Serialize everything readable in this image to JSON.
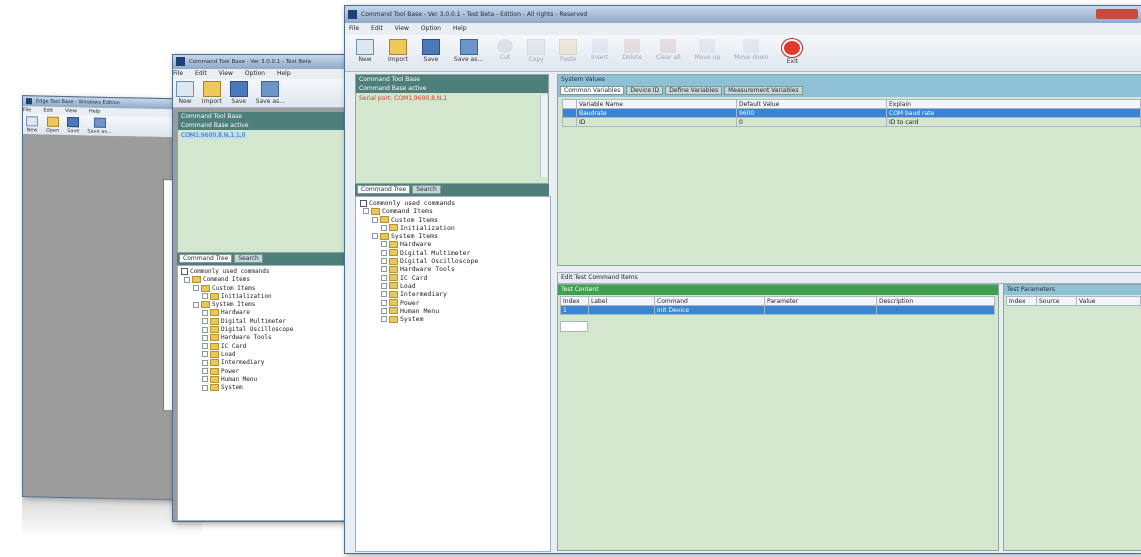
{
  "windows": {
    "back": {
      "title": "Edge Tool Base - Windows Edition",
      "menu": [
        "File",
        "Edit",
        "View",
        "Help"
      ],
      "toolbar": [
        "New",
        "Open",
        "Save",
        "Save as..."
      ]
    },
    "middle": {
      "title": "Command Tool Base - Ver 3.0.0.1 - Test Beta",
      "menu": [
        "File",
        "Edit",
        "View",
        "Option",
        "Help"
      ],
      "toolbar": [
        "New",
        "Import",
        "Save",
        "Save as..."
      ],
      "info_lines": [
        "Command Tool Base",
        "Command Base active"
      ],
      "info_value": "COM1:9600,8,N,1,1,0",
      "tabs": [
        "Command Tree",
        "Search"
      ],
      "filter_label": "Commonly used commands",
      "tree": [
        {
          "indent": 0,
          "label": "Command Items"
        },
        {
          "indent": 1,
          "label": "Custom Items"
        },
        {
          "indent": 2,
          "label": "Initialization"
        },
        {
          "indent": 1,
          "label": "System Items"
        },
        {
          "indent": 2,
          "label": "Hardware"
        },
        {
          "indent": 2,
          "label": "Digital Multimeter"
        },
        {
          "indent": 2,
          "label": "Digital Oscilloscope"
        },
        {
          "indent": 2,
          "label": "Hardware Tools"
        },
        {
          "indent": 2,
          "label": "IC Card"
        },
        {
          "indent": 2,
          "label": "Load"
        },
        {
          "indent": 2,
          "label": "Intermediary"
        },
        {
          "indent": 2,
          "label": "Power"
        },
        {
          "indent": 2,
          "label": "Human Menu"
        },
        {
          "indent": 2,
          "label": "System"
        }
      ]
    },
    "front": {
      "title": "Command Tool Base - Ver 3.0.0.1 - Test Beta - Edition - All rights - Reserved",
      "menu": [
        "File",
        "Edit",
        "View",
        "Option",
        "Help"
      ],
      "toolbar": [
        {
          "label": "New",
          "icon": "new-icon",
          "enabled": true
        },
        {
          "label": "Import",
          "icon": "open-icon",
          "enabled": true
        },
        {
          "label": "Save",
          "icon": "save-icon",
          "enabled": true
        },
        {
          "label": "Save as...",
          "icon": "save-as-icon",
          "enabled": true
        },
        {
          "label": "Cut",
          "icon": "cut-icon",
          "enabled": false
        },
        {
          "label": "Copy",
          "icon": "copy-icon",
          "enabled": false
        },
        {
          "label": "Paste",
          "icon": "paste-icon",
          "enabled": false
        },
        {
          "label": "Insert",
          "icon": "insert-icon",
          "enabled": false
        },
        {
          "label": "Delete",
          "icon": "delete-icon",
          "enabled": false
        },
        {
          "label": "Clear all",
          "icon": "clear-icon",
          "enabled": false
        },
        {
          "label": "Move up",
          "icon": "move-up-icon",
          "enabled": false
        },
        {
          "label": "Move down",
          "icon": "move-down-icon",
          "enabled": false
        },
        {
          "label": "Exit",
          "icon": "exit-icon",
          "enabled": true
        }
      ],
      "info_lines": [
        "Command Tool Base",
        "Command Base active"
      ],
      "info_value": "Serial port: COM1,9600,8,N,1",
      "tabs": [
        "Command Tree",
        "Search"
      ],
      "filter_label": "Commonly used commands",
      "tree": [
        {
          "indent": 0,
          "label": "Command Items"
        },
        {
          "indent": 1,
          "label": "Custom Items"
        },
        {
          "indent": 2,
          "label": "Initialization"
        },
        {
          "indent": 1,
          "label": "System Items"
        },
        {
          "indent": 2,
          "label": "Hardware"
        },
        {
          "indent": 2,
          "label": "Digital Multimeter"
        },
        {
          "indent": 2,
          "label": "Digital Oscilloscope"
        },
        {
          "indent": 2,
          "label": "Hardware Tools"
        },
        {
          "indent": 2,
          "label": "IC Card"
        },
        {
          "indent": 2,
          "label": "Load"
        },
        {
          "indent": 2,
          "label": "Intermediary"
        },
        {
          "indent": 2,
          "label": "Power"
        },
        {
          "indent": 2,
          "label": "Human Menu"
        },
        {
          "indent": 2,
          "label": "System"
        }
      ],
      "variables": {
        "title": "System Values",
        "tabs": [
          "Common Variables",
          "Device ID",
          "Define Variables",
          "Measurement Variables"
        ],
        "columns": [
          "Variable Name",
          "Default Value",
          "Explain"
        ],
        "rows": [
          {
            "name": "Baudrate",
            "value": "9600",
            "explain": "COM baud rate",
            "selected": true
          },
          {
            "name": "ID",
            "value": "0",
            "explain": "ID to card",
            "selected": false
          }
        ]
      },
      "edit_section": "Edit Test Command Items",
      "test_content": {
        "title": "Test Content",
        "columns": [
          "Index",
          "Label",
          "Command",
          "Parameter",
          "Description"
        ],
        "rows": [
          {
            "index": "1",
            "label": "",
            "command": "Init Device",
            "parameter": "",
            "description": "",
            "selected": true
          }
        ]
      },
      "test_parameters": {
        "title": "Test Parameters",
        "columns": [
          "Index",
          "Source",
          "Value"
        ]
      }
    }
  },
  "colors": {
    "panel_green": "#d3e7cf",
    "header_teal": "#4f7f7a",
    "selection_blue": "#3a84d6",
    "values_bar": "#8fc1d6",
    "test_bar": "#3f9f4f"
  }
}
